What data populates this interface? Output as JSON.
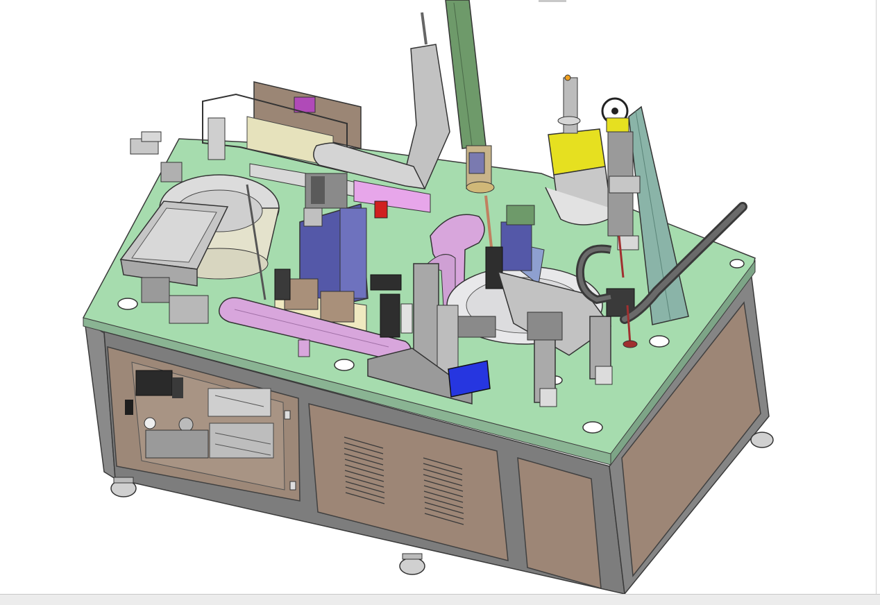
{
  "window": {
    "title": ""
  },
  "viewport": {
    "model_name": "automated-assembly-machine-3d-model"
  },
  "colors": {
    "background": "#ffffff",
    "table_top": "#a6dcae",
    "frame": "#7d7d7d",
    "panel": "#9a8472",
    "accent_pink": "#d8a6dc",
    "accent_blue": "#5458a8",
    "accent_yellow": "#e6e020",
    "accent_green": "#6e9a6a"
  },
  "statusbar": {
    "text": ""
  }
}
